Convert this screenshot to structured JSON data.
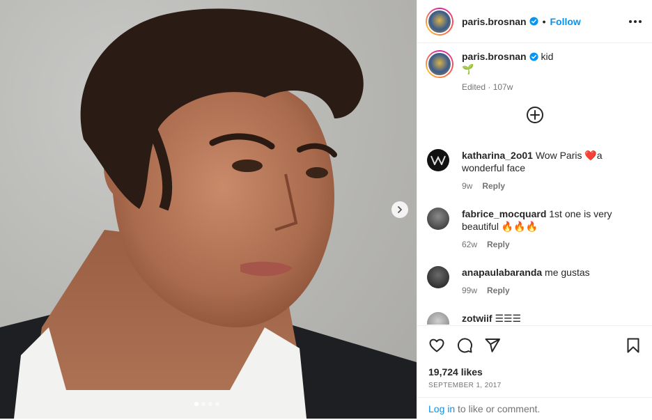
{
  "post": {
    "username": "paris.brosnan",
    "follow_label": "Follow",
    "separator": "•",
    "caption_text": "kid",
    "caption_emoji": "🌱",
    "caption_meta": "Edited · 107w",
    "likes": "19,724 likes",
    "date": "SEPTEMBER 1, 2017",
    "carousel": {
      "total": 4,
      "current": 1
    }
  },
  "comments": [
    {
      "user": "katharina_2o01",
      "text": "Wow Paris ❤️a wonderful face",
      "age": "9w",
      "reply": "Reply"
    },
    {
      "user": "fabrice_mocquard",
      "text": "1st one is very beautiful 🔥🔥🔥",
      "age": "62w",
      "reply": "Reply"
    },
    {
      "user": "anapaulabaranda",
      "text": "me gustas",
      "age": "99w",
      "reply": "Reply"
    },
    {
      "user": "zotwiif",
      "text": "☰☰☰",
      "age": "",
      "reply": ""
    }
  ],
  "footer": {
    "login_link": "Log in",
    "login_rest": " to like or comment."
  },
  "colors": {
    "accent": "#0095f6",
    "verified": "#0095f6",
    "muted": "#737373"
  },
  "icons": [
    "more-icon",
    "verified-icon",
    "add-icon",
    "heart-icon",
    "comment-icon",
    "share-icon",
    "bookmark-icon",
    "chevron-right-icon"
  ]
}
